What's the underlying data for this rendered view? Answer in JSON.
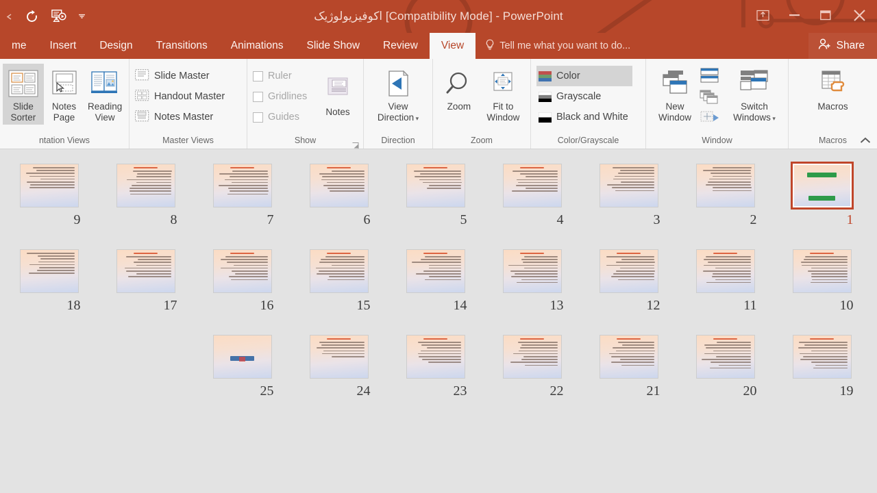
{
  "window": {
    "title": "اکوفیزیولوژیک [Compatibility Mode] - PowerPoint",
    "quick_access": [
      {
        "name": "redo",
        "glyph": "↻"
      },
      {
        "name": "start-slideshow",
        "glyph": "▶"
      },
      {
        "name": "customize-quick-access-toolbar",
        "glyph": "▾"
      }
    ],
    "controls": [
      {
        "name": "ribbon-display-options",
        "label": "Ribbon Display Options"
      },
      {
        "name": "minimize",
        "label": "Minimize"
      },
      {
        "name": "restore",
        "label": "Restore Down"
      },
      {
        "name": "close",
        "label": "Close"
      }
    ]
  },
  "tabs": [
    {
      "label": "me",
      "active": false
    },
    {
      "label": "Insert",
      "active": false
    },
    {
      "label": "Design",
      "active": false
    },
    {
      "label": "Transitions",
      "active": false
    },
    {
      "label": "Animations",
      "active": false
    },
    {
      "label": "Slide Show",
      "active": false
    },
    {
      "label": "Review",
      "active": false
    },
    {
      "label": "View",
      "active": true
    }
  ],
  "tell_me": "Tell me what you want to do...",
  "share": "Share",
  "ribbon": {
    "groups": [
      {
        "label": "ntation Views",
        "buttons": [
          {
            "label_top": "Slide",
            "label_bottom": "Sorter",
            "selected": true
          },
          {
            "label_top": "Notes",
            "label_bottom": "Page",
            "selected": false
          },
          {
            "label_top": "Reading",
            "label_bottom": "View",
            "selected": false
          }
        ]
      },
      {
        "label": "Master Views",
        "items": [
          {
            "label": "Slide Master"
          },
          {
            "label": "Handout Master"
          },
          {
            "label": "Notes Master"
          }
        ]
      },
      {
        "label": "Show",
        "checkboxes": [
          {
            "label": "Ruler",
            "checked": false
          },
          {
            "label": "Gridlines",
            "checked": false
          },
          {
            "label": "Guides",
            "checked": false
          }
        ],
        "buttons": [
          {
            "label_top": "Notes",
            "label_bottom": ""
          }
        ],
        "has_dialog_launcher": true
      },
      {
        "label": "Direction",
        "buttons": [
          {
            "label_top": "View",
            "label_bottom": "Direction",
            "dropdown": true
          }
        ]
      },
      {
        "label": "Zoom",
        "buttons": [
          {
            "label_top": "Zoom",
            "label_bottom": ""
          },
          {
            "label_top": "Fit to",
            "label_bottom": "Window"
          }
        ]
      },
      {
        "label": "Color/Grayscale",
        "items": [
          {
            "label": "Color",
            "selected": true,
            "swatch": "color"
          },
          {
            "label": "Grayscale",
            "selected": false,
            "swatch": "grayscale"
          },
          {
            "label": "Black and White",
            "selected": false,
            "swatch": "bw"
          }
        ]
      },
      {
        "label": "Window",
        "buttons": [
          {
            "label_top": "New",
            "label_bottom": "Window"
          },
          {
            "label_top": "Switch",
            "label_bottom": "Windows",
            "dropdown": true
          }
        ],
        "small_icons": [
          {
            "name": "arrange-all-icon"
          },
          {
            "name": "cascade-icon"
          },
          {
            "name": "move-split-icon"
          }
        ]
      },
      {
        "label": "Macros",
        "buttons": [
          {
            "label_top": "Macros",
            "label_bottom": ""
          }
        ]
      }
    ],
    "collapse_label": "Collapse the Ribbon"
  },
  "sorter": {
    "rows": [
      [
        {
          "num": "9",
          "kind": "text",
          "selected": false,
          "head": false,
          "lines": 8
        },
        {
          "num": "8",
          "kind": "text",
          "selected": false,
          "head": true,
          "lines": 9
        },
        {
          "num": "7",
          "kind": "text",
          "selected": false,
          "head": true,
          "lines": 9
        },
        {
          "num": "6",
          "kind": "text",
          "selected": false,
          "head": true,
          "lines": 8
        },
        {
          "num": "5",
          "kind": "text",
          "selected": false,
          "head": true,
          "lines": 7
        },
        {
          "num": "4",
          "kind": "text",
          "selected": false,
          "head": true,
          "lines": 8
        },
        {
          "num": "3",
          "kind": "text",
          "selected": false,
          "head": false,
          "lines": 9
        },
        {
          "num": "2",
          "kind": "text",
          "selected": false,
          "head": false,
          "lines": 9
        },
        {
          "num": "1",
          "kind": "title",
          "selected": true,
          "head": false,
          "lines": 0
        }
      ],
      [
        {
          "num": "18",
          "kind": "text",
          "selected": false,
          "head": false,
          "lines": 8
        },
        {
          "num": "17",
          "kind": "text",
          "selected": false,
          "head": true,
          "lines": 8
        },
        {
          "num": "16",
          "kind": "text",
          "selected": false,
          "head": true,
          "lines": 9
        },
        {
          "num": "15",
          "kind": "text",
          "selected": false,
          "head": true,
          "lines": 9
        },
        {
          "num": "14",
          "kind": "text",
          "selected": false,
          "head": true,
          "lines": 9
        },
        {
          "num": "13",
          "kind": "text",
          "selected": false,
          "head": true,
          "lines": 10
        },
        {
          "num": "12",
          "kind": "text",
          "selected": false,
          "head": true,
          "lines": 9
        },
        {
          "num": "11",
          "kind": "text",
          "selected": false,
          "head": true,
          "lines": 10
        },
        {
          "num": "10",
          "kind": "text",
          "selected": false,
          "head": true,
          "lines": 10
        }
      ],
      [
        {
          "num": "",
          "kind": "empty",
          "selected": false,
          "head": false,
          "lines": 0
        },
        {
          "num": "",
          "kind": "empty",
          "selected": false,
          "head": false,
          "lines": 0
        },
        {
          "num": "25",
          "kind": "end",
          "selected": false,
          "head": false,
          "lines": 0
        },
        {
          "num": "24",
          "kind": "text",
          "selected": false,
          "head": true,
          "lines": 6
        },
        {
          "num": "23",
          "kind": "text",
          "selected": false,
          "head": true,
          "lines": 8
        },
        {
          "num": "22",
          "kind": "text",
          "selected": false,
          "head": true,
          "lines": 9
        },
        {
          "num": "21",
          "kind": "text",
          "selected": false,
          "head": true,
          "lines": 9
        },
        {
          "num": "20",
          "kind": "text",
          "selected": false,
          "head": true,
          "lines": 10
        },
        {
          "num": "19",
          "kind": "text",
          "selected": false,
          "head": true,
          "lines": 10
        }
      ]
    ]
  },
  "colors": {
    "accent": "#b7472a",
    "selection": "#c0462a",
    "ribbon_bg": "#f7f7f7",
    "sorter_bg": "#e3e3e3"
  }
}
